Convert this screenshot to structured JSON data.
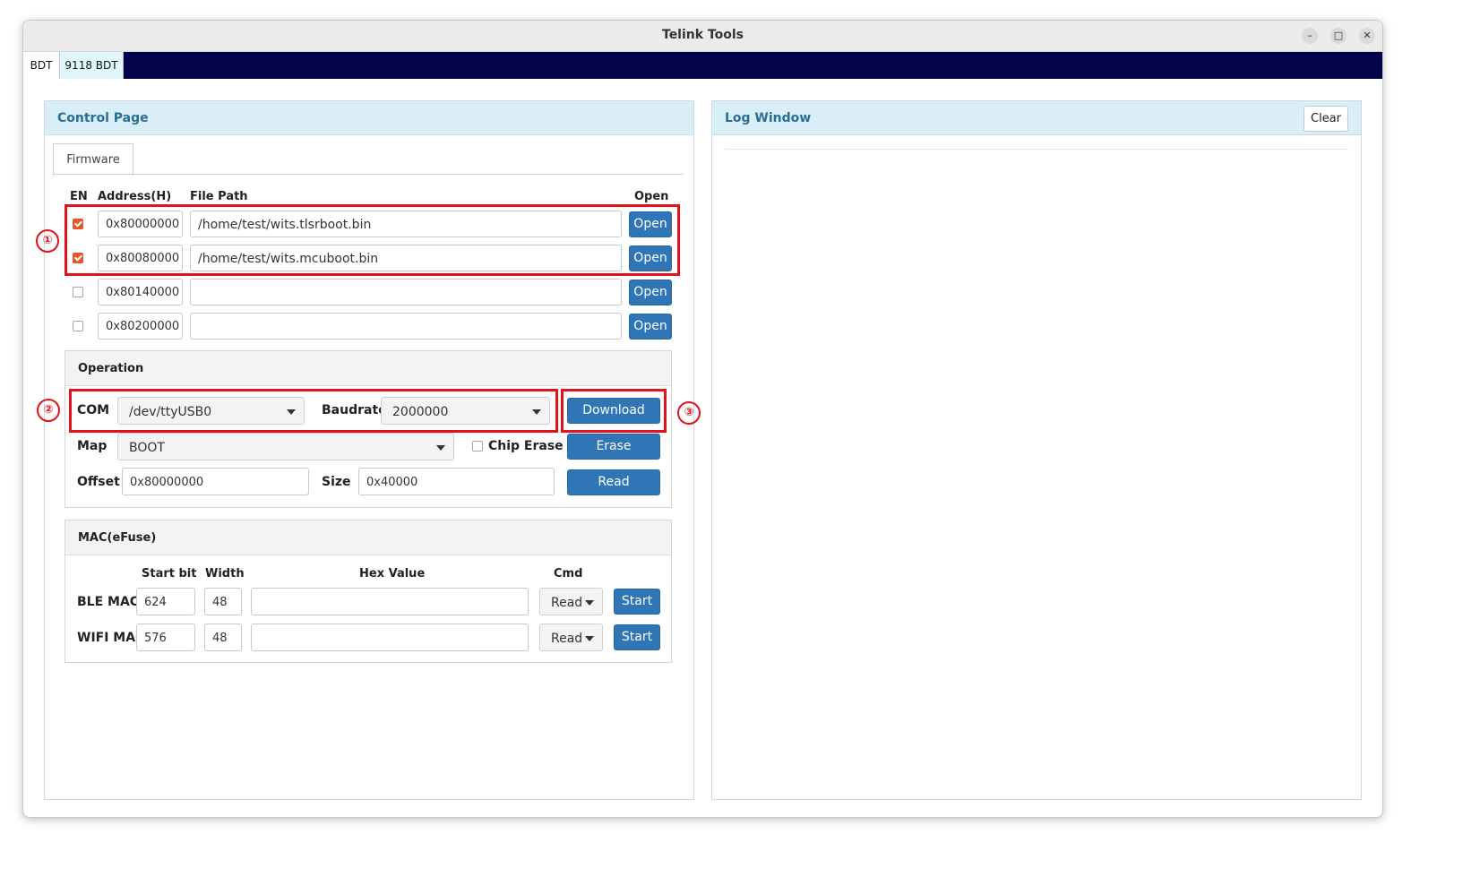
{
  "window": {
    "title": "Telink Tools"
  },
  "app_tabs": [
    {
      "label": "BDT"
    },
    {
      "label": "9118 BDT"
    }
  ],
  "control_panel": {
    "title": "Control Page",
    "subtab": "Firmware",
    "headers": {
      "en": "EN",
      "address": "Address(H)",
      "file_path": "File Path",
      "open": "Open"
    },
    "rows": [
      {
        "enabled": true,
        "address": "0x80000000",
        "path": "/home/test/wits.tlsrboot.bin",
        "button": "Open"
      },
      {
        "enabled": true,
        "address": "0x80080000",
        "path": "/home/test/wits.mcuboot.bin",
        "button": "Open"
      },
      {
        "enabled": false,
        "address": "0x80140000",
        "path": "",
        "button": "Open"
      },
      {
        "enabled": false,
        "address": "0x80200000",
        "path": "",
        "button": "Open"
      }
    ],
    "operation": {
      "title": "Operation",
      "com_label": "COM",
      "com_value": "/dev/ttyUSB0",
      "baudrate_label": "Baudrate",
      "baudrate_value": "2000000",
      "download_button": "Download",
      "map_label": "Map",
      "map_value": "BOOT",
      "chip_erase_label": "Chip Erase",
      "chip_erase_checked": false,
      "erase_button": "Erase",
      "offset_label": "Offset",
      "offset_value": "0x80000000",
      "size_label": "Size",
      "size_value": "0x40000",
      "read_button": "Read"
    },
    "mac": {
      "title": "MAC(eFuse)",
      "headers": {
        "start_bit": "Start bit",
        "width": "Width",
        "hex_value": "Hex Value",
        "cmd": "Cmd"
      },
      "rows": [
        {
          "label": "BLE MAC",
          "start_bit": "624",
          "width": "48",
          "hex": "",
          "cmd": "Read",
          "button": "Start"
        },
        {
          "label": "WIFI MAC",
          "start_bit": "576",
          "width": "48",
          "hex": "",
          "cmd": "Read",
          "button": "Start"
        }
      ]
    }
  },
  "log_panel": {
    "title": "Log Window",
    "clear_button": "Clear"
  },
  "annotations": {
    "marker_1": "①",
    "marker_2": "②",
    "marker_3": "③",
    "color": "#e1121b"
  },
  "colors": {
    "accent": "#3076b7",
    "menubar": "#02034a",
    "panel_header": "#d9eef7",
    "checkbox": "#e8552a"
  }
}
